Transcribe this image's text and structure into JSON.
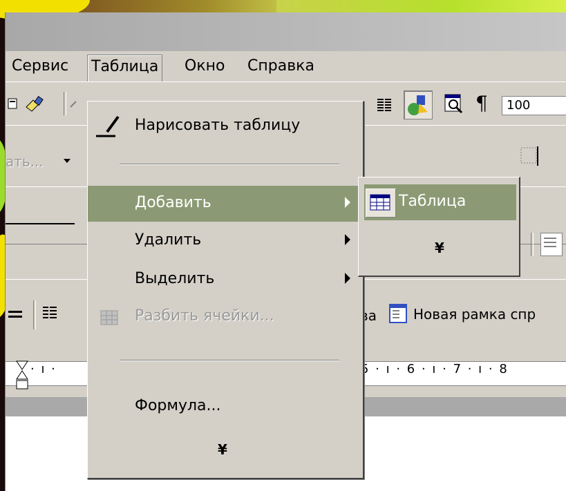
{
  "menubar": {
    "items": [
      {
        "label": "Сервис"
      },
      {
        "label": "Таблица"
      },
      {
        "label": "Окно"
      },
      {
        "label": "Справка"
      }
    ]
  },
  "toolbar1": {
    "zoom_value": "100"
  },
  "toolbar2": {
    "style_value": "ать...",
    "border_button_glyph": "⊞"
  },
  "toolbar4": {
    "new_frame_label": "Новая рамка спр",
    "left_fragment": "ва"
  },
  "ruler": {
    "left_marks": "· ı ·",
    "right_marks": "5 · ı · 6 · ı · 7 · ı · 8"
  },
  "dropdown": {
    "items": [
      {
        "label": "Нарисовать таблицу",
        "icon": "pencil-icon",
        "enabled": true
      },
      {
        "label": "Добавить",
        "submenu": true,
        "enabled": true,
        "highlighted": true
      },
      {
        "label": "Удалить",
        "submenu": true,
        "enabled": true
      },
      {
        "label": "Выделить",
        "submenu": true,
        "enabled": true
      },
      {
        "label": "Разбить ячейки...",
        "icon": "split-cells-icon",
        "enabled": false
      },
      {
        "label": "Формула...",
        "enabled": true
      }
    ],
    "expand_glyph": "¥"
  },
  "submenu": {
    "items": [
      {
        "label": "Таблица",
        "icon": "insert-table-icon",
        "highlighted": true
      }
    ],
    "expand_glyph": "¥"
  },
  "colors": {
    "highlight": "#8b9a74",
    "window_face": "#d4d0c8",
    "disabled_text": "#9a9a9a"
  }
}
